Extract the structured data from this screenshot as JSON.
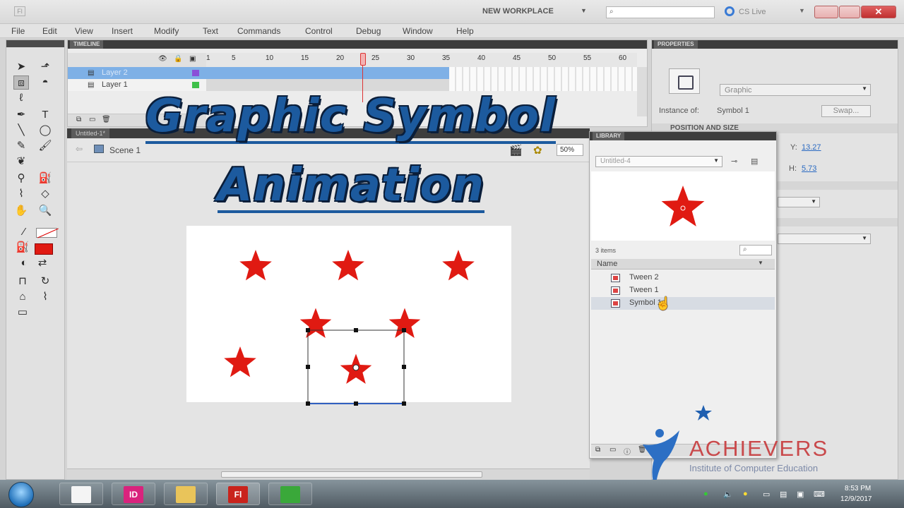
{
  "titlebar": {
    "app_icon": "Fl",
    "workspace_label": "NEW WORKPLACE",
    "cs_live_label": "CS Live",
    "close_glyph": "✕"
  },
  "menu": [
    "File",
    "Edit",
    "View",
    "Insert",
    "Modify",
    "Text",
    "Commands",
    "Control",
    "Debug",
    "Window",
    "Help"
  ],
  "tools": {
    "icons": [
      "selection-arrow-icon",
      "subselection-arrow-icon",
      "free-transform-icon",
      "3d-rotation-icon",
      "lasso-icon",
      "pen-icon",
      "text-icon",
      "line-icon",
      "oval-icon",
      "pencil-icon",
      "brush-icon",
      "deco-icon",
      "bone-icon",
      "paint-bucket-icon",
      "eyedropper-icon",
      "eraser-icon",
      "hand-icon",
      "zoom-icon"
    ]
  },
  "timeline": {
    "tab_label": "TIMELINE",
    "frame_numbers": [
      "1",
      "5",
      "10",
      "15",
      "20",
      "25",
      "30",
      "35",
      "40",
      "45",
      "50",
      "55",
      "60"
    ],
    "layers": [
      {
        "name": "Layer 2",
        "color": "#8a4fd8"
      },
      {
        "name": "Layer 1",
        "color": "#3fc04a"
      }
    ],
    "current_frame": 24
  },
  "document": {
    "tab_label": "Untitled-1*",
    "scene_label": "Scene 1",
    "zoom": "50%"
  },
  "overlay": {
    "title_line1": "Graphic Symbol",
    "title_line2": "Animation"
  },
  "properties": {
    "tab_label": "PROPERTIES",
    "symbol_type": "Graphic",
    "instance_of_label": "Instance of:",
    "instance_of_value": "Symbol 1",
    "swap_label": "Swap...",
    "section_position": "POSITION AND SIZE",
    "y_label": "Y:",
    "y_value": "13.27",
    "h_label": "H:",
    "h_value": "5.73"
  },
  "library": {
    "tab_label": "LIBRARY",
    "document_name": "Untitled-4",
    "item_count": "3 items",
    "column_name": "Name",
    "items": [
      "Tween 2",
      "Tween 1",
      "Symbol 1"
    ]
  },
  "watermark": {
    "name": "ACHIEVERS",
    "subtitle": "Institute of Computer Education"
  },
  "taskbar": {
    "apps": [
      {
        "name": "notepad",
        "glyph": "",
        "color": "#f4f4f4"
      },
      {
        "name": "indesign",
        "glyph": "ID",
        "color": "#d9237d"
      },
      {
        "name": "explorer",
        "glyph": "",
        "color": "#e9c45a"
      },
      {
        "name": "flash",
        "glyph": "Fl",
        "color": "#c9231c"
      },
      {
        "name": "browser",
        "glyph": "",
        "color": "#3aa83a"
      }
    ],
    "time": "8:53 PM",
    "date": "12/9/2017"
  },
  "colors": {
    "star_fill": "#e01a12",
    "accent_blue": "#1c5a9e",
    "layer_selected": "#7eb0e6"
  }
}
